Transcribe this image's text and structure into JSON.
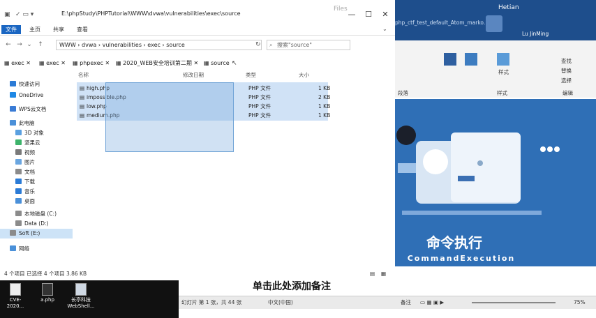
{
  "explorer": {
    "app_title": "Files",
    "ribbon_tabs": [
      "文件",
      "主页",
      "共享",
      "查看"
    ],
    "address": "E:\\phpStudy\\PHPTutorial\\WWW\\dvwa\\vulnerabilities\\exec\\source",
    "breadcrumb": [
      "WWW",
      "dvwa",
      "vulnerabilities",
      "exec",
      "source"
    ],
    "search_placeholder": "搜索\"source\"",
    "tabs": [
      "exec",
      "exec",
      "phpexec",
      "2020_WEB安全培训第二期",
      "source"
    ],
    "nav": [
      {
        "label": "快速访问",
        "color": "#2b7bd6"
      },
      {
        "label": "OneDrive",
        "color": "#1e88e5"
      },
      {
        "label": "WPS云文档",
        "color": "#3a7bd5"
      },
      {
        "label": "此电脑",
        "color": "#4a90d9"
      },
      {
        "label": "3D 对象",
        "color": "#5aa0e0"
      },
      {
        "label": "坚果云",
        "color": "#3db36b"
      },
      {
        "label": "视频",
        "color": "#7a7a7a"
      },
      {
        "label": "图片",
        "color": "#6aa6e0"
      },
      {
        "label": "文档",
        "color": "#8b8b8b"
      },
      {
        "label": "下载",
        "color": "#2b7bd6"
      },
      {
        "label": "音乐",
        "color": "#2b7bd6"
      },
      {
        "label": "桌面",
        "color": "#4a90d9"
      },
      {
        "label": "本地磁盘 (C:)",
        "color": "#8b8b8b"
      },
      {
        "label": "Data (D:)",
        "color": "#8b8b8b"
      },
      {
        "label": "Soft (E:)",
        "color": "#8b8b8b"
      },
      {
        "label": "网络",
        "color": "#4a90d9"
      }
    ],
    "columns": [
      "名称",
      "修改日期",
      "类型",
      "大小"
    ],
    "files": [
      {
        "name": "high.php",
        "type": "PHP 文件",
        "size": "1 KB"
      },
      {
        "name": "impossible.php",
        "type": "PHP 文件",
        "size": "2 KB"
      },
      {
        "name": "low.php",
        "type": "PHP 文件",
        "size": "1 KB"
      },
      {
        "name": "medium.php",
        "type": "PHP 文件",
        "size": "1 KB"
      }
    ],
    "status": "4 个项目   已选择 4 个项目  3.86 KB"
  },
  "word": {
    "window_title": "Hetian",
    "doc_line": "php_ctf_test_default_Atom_marko...",
    "user": "Lu JinMing",
    "ribbon_groups": [
      "段落",
      "样式"
    ],
    "ribbon_buttons": [
      "查找",
      "替换",
      "选择",
      "编辑",
      "样式",
      "段落"
    ],
    "slide_title": "命令执行",
    "slide_subtitle": "CommandExecution",
    "notes_placeholder": "单击此处添加备注",
    "status_left": "幻灯片 第 1 张，共 44 张",
    "status_lang": "中文(中国)",
    "status_notes": "备注",
    "zoom": "75%"
  },
  "desktop": {
    "icons": [
      "CVE-2020...",
      "a.php",
      "长亭科技 WebShell..."
    ]
  }
}
